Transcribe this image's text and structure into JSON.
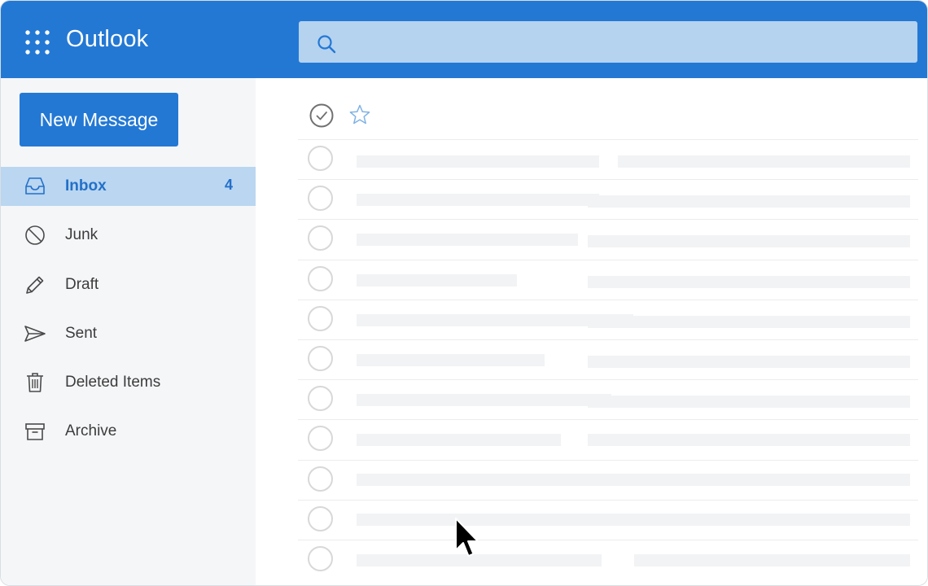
{
  "header": {
    "app_title": "Outlook",
    "app_launcher_icon": "waffle-icon",
    "search": {
      "placeholder": "",
      "value": "",
      "icon": "search-icon"
    }
  },
  "sidebar": {
    "new_message_label": "New Message",
    "items": [
      {
        "label": "Inbox",
        "icon": "inbox-icon",
        "count": "4",
        "active": true
      },
      {
        "label": "Junk",
        "icon": "block-icon",
        "count": "",
        "active": false
      },
      {
        "label": "Draft",
        "icon": "pencil-icon",
        "count": "",
        "active": false
      },
      {
        "label": "Sent",
        "icon": "send-icon",
        "count": "",
        "active": false
      },
      {
        "label": "Deleted Items",
        "icon": "trash-icon",
        "count": "",
        "active": false
      },
      {
        "label": "Archive",
        "icon": "archive-icon",
        "count": "",
        "active": false
      }
    ]
  },
  "message_list": {
    "toolbar": {
      "select_all_icon": "check-circle-icon",
      "favorite_icon": "star-icon"
    },
    "row_count": 11
  },
  "colors": {
    "accent": "#2378d4",
    "search_bg": "#b5d2ef",
    "active_nav_bg": "#bad6f1",
    "active_nav_text": "#2370c9",
    "sidebar_bg": "#f5f6f8",
    "placeholder_bar": "#f2f3f5"
  }
}
